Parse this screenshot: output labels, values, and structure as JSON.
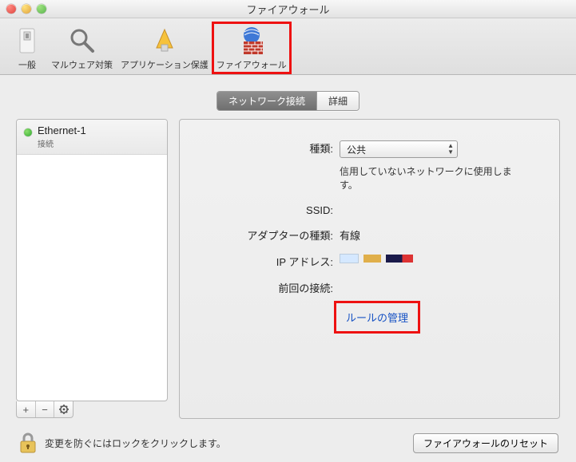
{
  "window": {
    "title": "ファイアウォール"
  },
  "toolbar": {
    "items": [
      {
        "label": "一般"
      },
      {
        "label": "マルウェア対策"
      },
      {
        "label": "アプリケーション保護"
      },
      {
        "label": "ファイアウォール"
      }
    ],
    "selected_index": 3
  },
  "tabs": {
    "network": "ネットワーク接続",
    "advanced": "詳細",
    "active": "network"
  },
  "connections": [
    {
      "name": "Ethernet-1",
      "status_label": "接続",
      "status": "connected"
    }
  ],
  "list_controls": {
    "add": "+",
    "remove": "−",
    "settings": "gear"
  },
  "detail": {
    "type_label": "種類:",
    "type_value": "公共",
    "type_description": "信用していないネットワークに使用します。",
    "ssid_label": "SSID:",
    "ssid_value": "",
    "adapter_label": "アダプターの種類:",
    "adapter_value": "有線",
    "ip_label": "IP アドレス:",
    "last_conn_label": "前回の接続:",
    "last_conn_value": "",
    "manage_rules": "ルールの管理"
  },
  "footer": {
    "lock_text": "変更を防ぐにはロックをクリックします。",
    "reset_button": "ファイアウォールのリセット"
  }
}
